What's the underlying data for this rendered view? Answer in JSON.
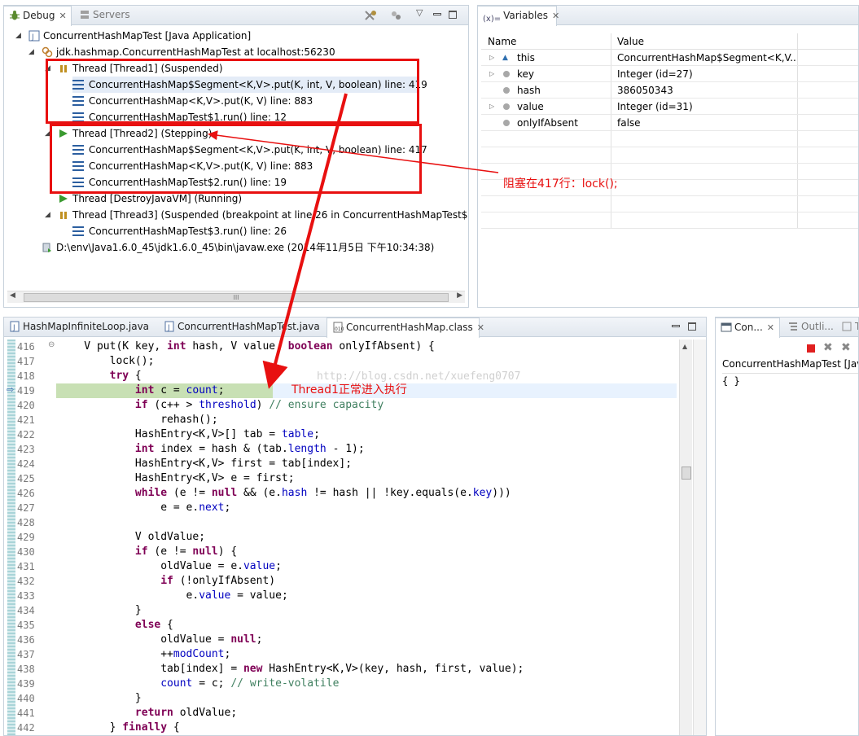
{
  "debug": {
    "tabs": {
      "debug": "Debug",
      "servers": "Servers"
    },
    "tree": [
      {
        "label": "ConcurrentHashMapTest [Java Application]"
      },
      {
        "label": "jdk.hashmap.ConcurrentHashMapTest at localhost:56230"
      },
      {
        "label": "Thread [Thread1] (Suspended)"
      },
      {
        "label": "ConcurrentHashMap$Segment<K,V>.put(K, int, V, boolean) line: 419"
      },
      {
        "label": "ConcurrentHashMap<K,V>.put(K, V) line: 883"
      },
      {
        "label": "ConcurrentHashMapTest$1.run() line: 12"
      },
      {
        "label": "Thread [Thread2] (Stepping)"
      },
      {
        "label": "ConcurrentHashMap$Segment<K,V>.put(K, int, V, boolean) line: 417"
      },
      {
        "label": "ConcurrentHashMap<K,V>.put(K, V) line: 883"
      },
      {
        "label": "ConcurrentHashMapTest$2.run() line: 19"
      },
      {
        "label": "Thread [DestroyJavaVM] (Running)"
      },
      {
        "label": "Thread [Thread3] (Suspended (breakpoint at line 26 in ConcurrentHashMapTest$3"
      },
      {
        "label": "ConcurrentHashMapTest$3.run() line: 26"
      },
      {
        "label": "D:\\env\\Java1.6.0_45\\jdk1.6.0_45\\bin\\javaw.exe (2014年11月5日 下午10:34:38)"
      }
    ],
    "scroll_thumb": "III"
  },
  "variables": {
    "tab": "Variables",
    "headers": {
      "name": "Name",
      "value": "Value"
    },
    "rows": [
      {
        "name": "this",
        "value": "ConcurrentHashMap$Segment<K,V..."
      },
      {
        "name": "key",
        "value": "Integer  (id=27)"
      },
      {
        "name": "hash",
        "value": "386050343"
      },
      {
        "name": "value",
        "value": "Integer  (id=31)"
      },
      {
        "name": "onlyIfAbsent",
        "value": "false"
      }
    ]
  },
  "editor": {
    "tabs": [
      "HashMapInfiniteLoop.java",
      "ConcurrentHashMapTest.java",
      "ConcurrentHashMap.class"
    ],
    "watermark": "http://blog.csdn.net/xuefeng0707",
    "lines": [
      {
        "n": "416",
        "t": "    V put(K key, int hash, V value, boolean onlyIfAbsent) {"
      },
      {
        "n": "417",
        "t": "        lock();"
      },
      {
        "n": "418",
        "t": "        try {"
      },
      {
        "n": "419",
        "t": "            int c = count;"
      },
      {
        "n": "420",
        "t": "            if (c++ > threshold) // ensure capacity"
      },
      {
        "n": "421",
        "t": "                rehash();"
      },
      {
        "n": "422",
        "t": "            HashEntry<K,V>[] tab = table;"
      },
      {
        "n": "423",
        "t": "            int index = hash & (tab.length - 1);"
      },
      {
        "n": "424",
        "t": "            HashEntry<K,V> first = tab[index];"
      },
      {
        "n": "425",
        "t": "            HashEntry<K,V> e = first;"
      },
      {
        "n": "426",
        "t": "            while (e != null && (e.hash != hash || !key.equals(e.key)))"
      },
      {
        "n": "427",
        "t": "                e = e.next;"
      },
      {
        "n": "428",
        "t": ""
      },
      {
        "n": "429",
        "t": "            V oldValue;"
      },
      {
        "n": "430",
        "t": "            if (e != null) {"
      },
      {
        "n": "431",
        "t": "                oldValue = e.value;"
      },
      {
        "n": "432",
        "t": "                if (!onlyIfAbsent)"
      },
      {
        "n": "433",
        "t": "                    e.value = value;"
      },
      {
        "n": "434",
        "t": "            }"
      },
      {
        "n": "435",
        "t": "            else {"
      },
      {
        "n": "436",
        "t": "                oldValue = null;"
      },
      {
        "n": "437",
        "t": "                ++modCount;"
      },
      {
        "n": "438",
        "t": "                tab[index] = new HashEntry<K,V>(key, hash, first, value);"
      },
      {
        "n": "439",
        "t": "                count = c; // write-volatile"
      },
      {
        "n": "440",
        "t": "            }"
      },
      {
        "n": "441",
        "t": "            return oldValue;"
      },
      {
        "n": "442",
        "t": "        } finally {"
      }
    ]
  },
  "console": {
    "tabs": [
      "Con...",
      "Outli...",
      "T"
    ],
    "title": "ConcurrentHashMapTest [Jav",
    "content": "{ }"
  },
  "annotations": {
    "blocked": "阻塞在417行：lock();",
    "running": "Thread1正常进入执行"
  },
  "colors": {
    "annotation": "#e81010",
    "current_line": "#c8e0b4",
    "keyword": "#7f0055",
    "field": "#0000c0",
    "comment": "#3f7f5f"
  }
}
